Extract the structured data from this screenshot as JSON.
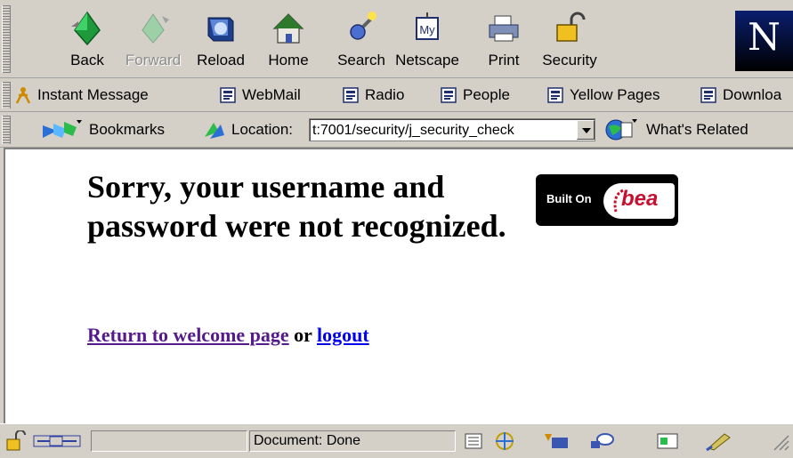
{
  "nav_toolbar": {
    "buttons": [
      {
        "label": "Back",
        "icon": "back-arrow-icon",
        "enabled": true
      },
      {
        "label": "Forward",
        "icon": "forward-arrow-icon",
        "enabled": false
      },
      {
        "label": "Reload",
        "icon": "reload-icon",
        "enabled": true
      },
      {
        "label": "Home",
        "icon": "home-icon",
        "enabled": true
      },
      {
        "label": "Search",
        "icon": "search-icon",
        "enabled": true
      },
      {
        "label": "Netscape",
        "icon": "my-netscape-icon",
        "enabled": true
      },
      {
        "label": "Print",
        "icon": "printer-icon",
        "enabled": true
      },
      {
        "label": "Security",
        "icon": "padlock-icon",
        "enabled": true
      }
    ],
    "logo_letter": "N"
  },
  "personal_toolbar": {
    "items": [
      {
        "label": "Instant Message",
        "icon": "instant-message-icon"
      },
      {
        "label": "WebMail",
        "icon": "bookmark-page-icon"
      },
      {
        "label": "Radio",
        "icon": "bookmark-page-icon"
      },
      {
        "label": "People",
        "icon": "bookmark-page-icon"
      },
      {
        "label": "Yellow Pages",
        "icon": "bookmark-page-icon"
      },
      {
        "label": "Downloa",
        "icon": "bookmark-page-icon"
      }
    ]
  },
  "location_toolbar": {
    "bookmarks_label": "Bookmarks",
    "location_label": "Location:",
    "url": "t:7001/security/j_security_check",
    "whats_related_label": "What's Related"
  },
  "page": {
    "message": "Sorry, your username and password were not recognized.",
    "return_link": "Return to welcome page",
    "or_text": "or",
    "logout_link": "logout",
    "badge_text": "Built On",
    "badge_brand": "bea"
  },
  "status_bar": {
    "status_text": "Document: Done"
  },
  "colors": {
    "chrome": "#d4d0c8",
    "visited_link": "#551a8b",
    "link": "#0000ee",
    "bea_red": "#c8102e"
  }
}
